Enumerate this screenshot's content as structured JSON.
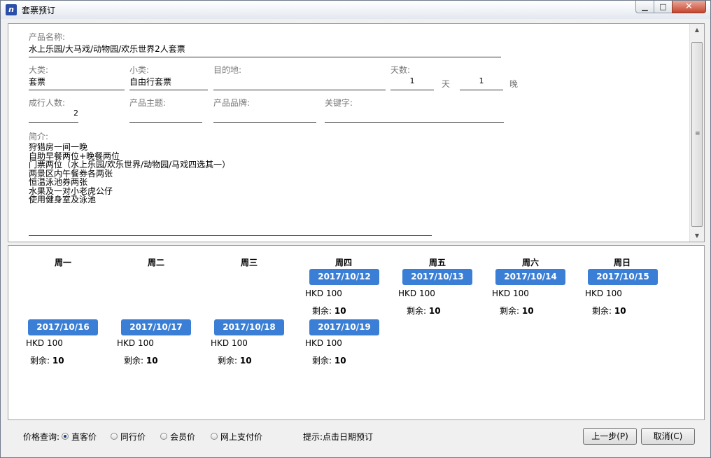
{
  "window": {
    "title": "套票预订",
    "app_icon": "app-icon",
    "minimize": "▁",
    "maximize": "□",
    "close": "✕"
  },
  "form": {
    "product_name_label": "产品名称:",
    "product_name": "水上乐园/大马戏/动物园/欢乐世界2人套票",
    "category_label": "大类:",
    "category": "套票",
    "subcategory_label": "小类:",
    "subcategory": "自由行套票",
    "destination_label": "目的地:",
    "destination": "",
    "days_label": "天数:",
    "days": "1",
    "days_unit": "天",
    "nights": "1",
    "nights_unit": "晚",
    "adults_label": "成行人数:",
    "adults": "2",
    "theme_label": "产品主题:",
    "theme": "",
    "brand_label": "产品品牌:",
    "brand": "",
    "keywords_label": "关键字:",
    "keywords": "",
    "intro_label": "简介:",
    "intro_lines": [
      "狩猎房一间一晚",
      "自助早餐两位+晚餐两位",
      "门票两位（水上乐园/欢乐世界/动物园/马戏四选其一）",
      "两景区内午餐券各两张",
      "恒温泳池券两张",
      "水果及一对小老虎公仔",
      "使用健身室及泳池"
    ]
  },
  "calendar": {
    "weekdays": [
      "周一",
      "周二",
      "周三",
      "周四",
      "周五",
      "周六",
      "周日"
    ],
    "price_prefix": "HKD",
    "remaining_label": "剩余:",
    "week1": [
      {
        "date": "2017/10/12",
        "price": "100",
        "remaining": "10"
      },
      {
        "date": "2017/10/13",
        "price": "100",
        "remaining": "10"
      },
      {
        "date": "2017/10/14",
        "price": "100",
        "remaining": "10"
      },
      {
        "date": "2017/10/15",
        "price": "100",
        "remaining": "10"
      }
    ],
    "week2": [
      {
        "date": "2017/10/16",
        "price": "100",
        "remaining": "10"
      },
      {
        "date": "2017/10/17",
        "price": "100",
        "remaining": "10"
      },
      {
        "date": "2017/10/18",
        "price": "100",
        "remaining": "10"
      },
      {
        "date": "2017/10/19",
        "price": "100",
        "remaining": "10"
      }
    ]
  },
  "footer": {
    "price_query_label": "价格查询:",
    "options": [
      "直客价",
      "同行价",
      "会员价",
      "网上支付价"
    ],
    "selected": "直客价",
    "hint": "提示:点击日期预订",
    "prev_button": "上一步(P)",
    "cancel_button": "取消(C)"
  },
  "colors": {
    "date_button": "#3a7fd5"
  }
}
